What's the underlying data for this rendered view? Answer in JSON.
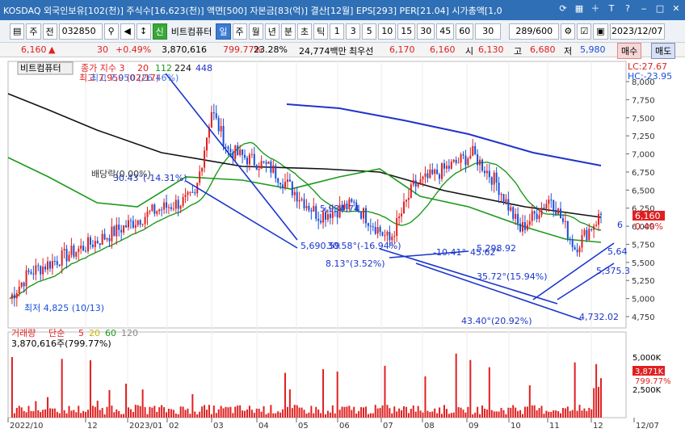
{
  "window": {
    "title": "KOSDAQ 외국인보유[102(천)] 주식수[16,623(천)] 액면[500] 자본금[83(억)] 결산[12월] EPS[293] PER[21.04] 시가총액[1,0"
  },
  "toolbar": {
    "stock_label": "주",
    "jeon_label": "전",
    "code": "032850",
    "name_tag": "신",
    "stock_name": "비트컴퓨터",
    "periods": [
      "일",
      "주",
      "월",
      "년",
      "분",
      "초",
      "틱"
    ],
    "selected_period": "일",
    "intervals": [
      "1",
      "3",
      "5",
      "10",
      "15",
      "30",
      "45",
      "60"
    ],
    "count_value": "30",
    "view_count": "289",
    "view_total": "/600",
    "date": "2023/12/07"
  },
  "pricebar": {
    "price": "6,160",
    "change": "30",
    "change_pct": "+0.49%",
    "volume": "3,870,616",
    "vol_ratio": "799.77%",
    "turnover": "23.28%",
    "amount": "24,774백만",
    "best_ask_label": "최우선",
    "best_ask": "6,170",
    "best_bid": "6,160",
    "open_label": "시",
    "open": "6,130",
    "high_label": "고",
    "high": "6,680",
    "low_label": "저",
    "low": "5,980",
    "sell_label": "매수",
    "buy_label": "매도"
  },
  "chart": {
    "tag": "비트컴퓨터",
    "ma_label": "종가 지수 3",
    "ma_periods": [
      "20",
      "112",
      "224",
      "448"
    ],
    "lc": "LC:27.67",
    "hc": "HC:-23.95",
    "high_note": "최고 7,950 (02/17)",
    "high_note2": "최고 7,950 (26.46%)",
    "low_note": "최저 4,825 (10/13)",
    "dividend_note": "배당락(0.00%)",
    "current_tag": "6,160",
    "current_pct": "0.49%",
    "annotations": [
      "30.43°(-14.31%)",
      "5,934.74",
      "5,690.59",
      "30.58°(-16.94%)",
      "8.13°(3.52%)",
      "-10.41°",
      "45.62°",
      "5,298.92",
      "35.72°(15.94%)",
      "43.40°(20.92%)",
      "4,732.02",
      "5,375.3",
      "5,64",
      "6"
    ],
    "volume_panel": {
      "label": "거래량",
      "ma_label": "단순",
      "ma_periods": [
        "5",
        "20",
        "60",
        "120"
      ],
      "volume_text": "3,870,616주(799.77%)",
      "axis": [
        "5,000K",
        "2,500K"
      ],
      "current_tag": "3,871K",
      "current_pct": "799.77%"
    },
    "x_axis": [
      "2022/10",
      "12",
      "2023/01",
      "02",
      "03",
      "04",
      "05",
      "06",
      "07",
      "08",
      "09",
      "10",
      "11",
      "12",
      "12/07"
    ],
    "y_axis": [
      "8,000",
      "7,750",
      "7,500",
      "7,250",
      "7,000",
      "6,750",
      "6,500",
      "6,250",
      "6,000",
      "5,750",
      "5,500",
      "5,250",
      "5,000",
      "4,750"
    ]
  },
  "colors": {
    "up": "#e02020",
    "down": "#1a4fd8",
    "ma20": "#1c9a1c",
    "ma112": "#111111",
    "ma224": "#2233cc",
    "title_bg": "#2f6fb5"
  }
}
